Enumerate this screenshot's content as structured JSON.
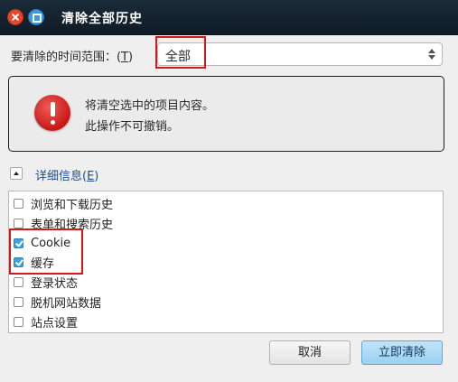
{
  "window": {
    "title": "清除全部历史",
    "close_icon": "close-icon",
    "maximize_icon": "maximize-icon"
  },
  "time_range": {
    "label": "要清除的时间范围：(",
    "accesskey": "T",
    "label_suffix": ")",
    "selected": "全部"
  },
  "warning": {
    "icon": "warning-icon",
    "line1": "将清空选中的项目内容。",
    "line2": "此操作不可撤销。"
  },
  "details": {
    "label": "详细信息(",
    "accesskey": "E",
    "label_suffix": ")",
    "expanded": true
  },
  "items": [
    {
      "label": "浏览和下载历史",
      "checked": false
    },
    {
      "label": "表单和搜索历史",
      "checked": false
    },
    {
      "label": "Cookie",
      "checked": true
    },
    {
      "label": "缓存",
      "checked": true
    },
    {
      "label": "登录状态",
      "checked": false
    },
    {
      "label": "脱机网站数据",
      "checked": false
    },
    {
      "label": "站点设置",
      "checked": false
    }
  ],
  "buttons": {
    "cancel": "取消",
    "clear_now": "立即清除"
  },
  "colors": {
    "titlebar": "#132230",
    "highlight": "#d21a1a",
    "accent": "#3aa2e0",
    "link": "#1c4f92"
  }
}
